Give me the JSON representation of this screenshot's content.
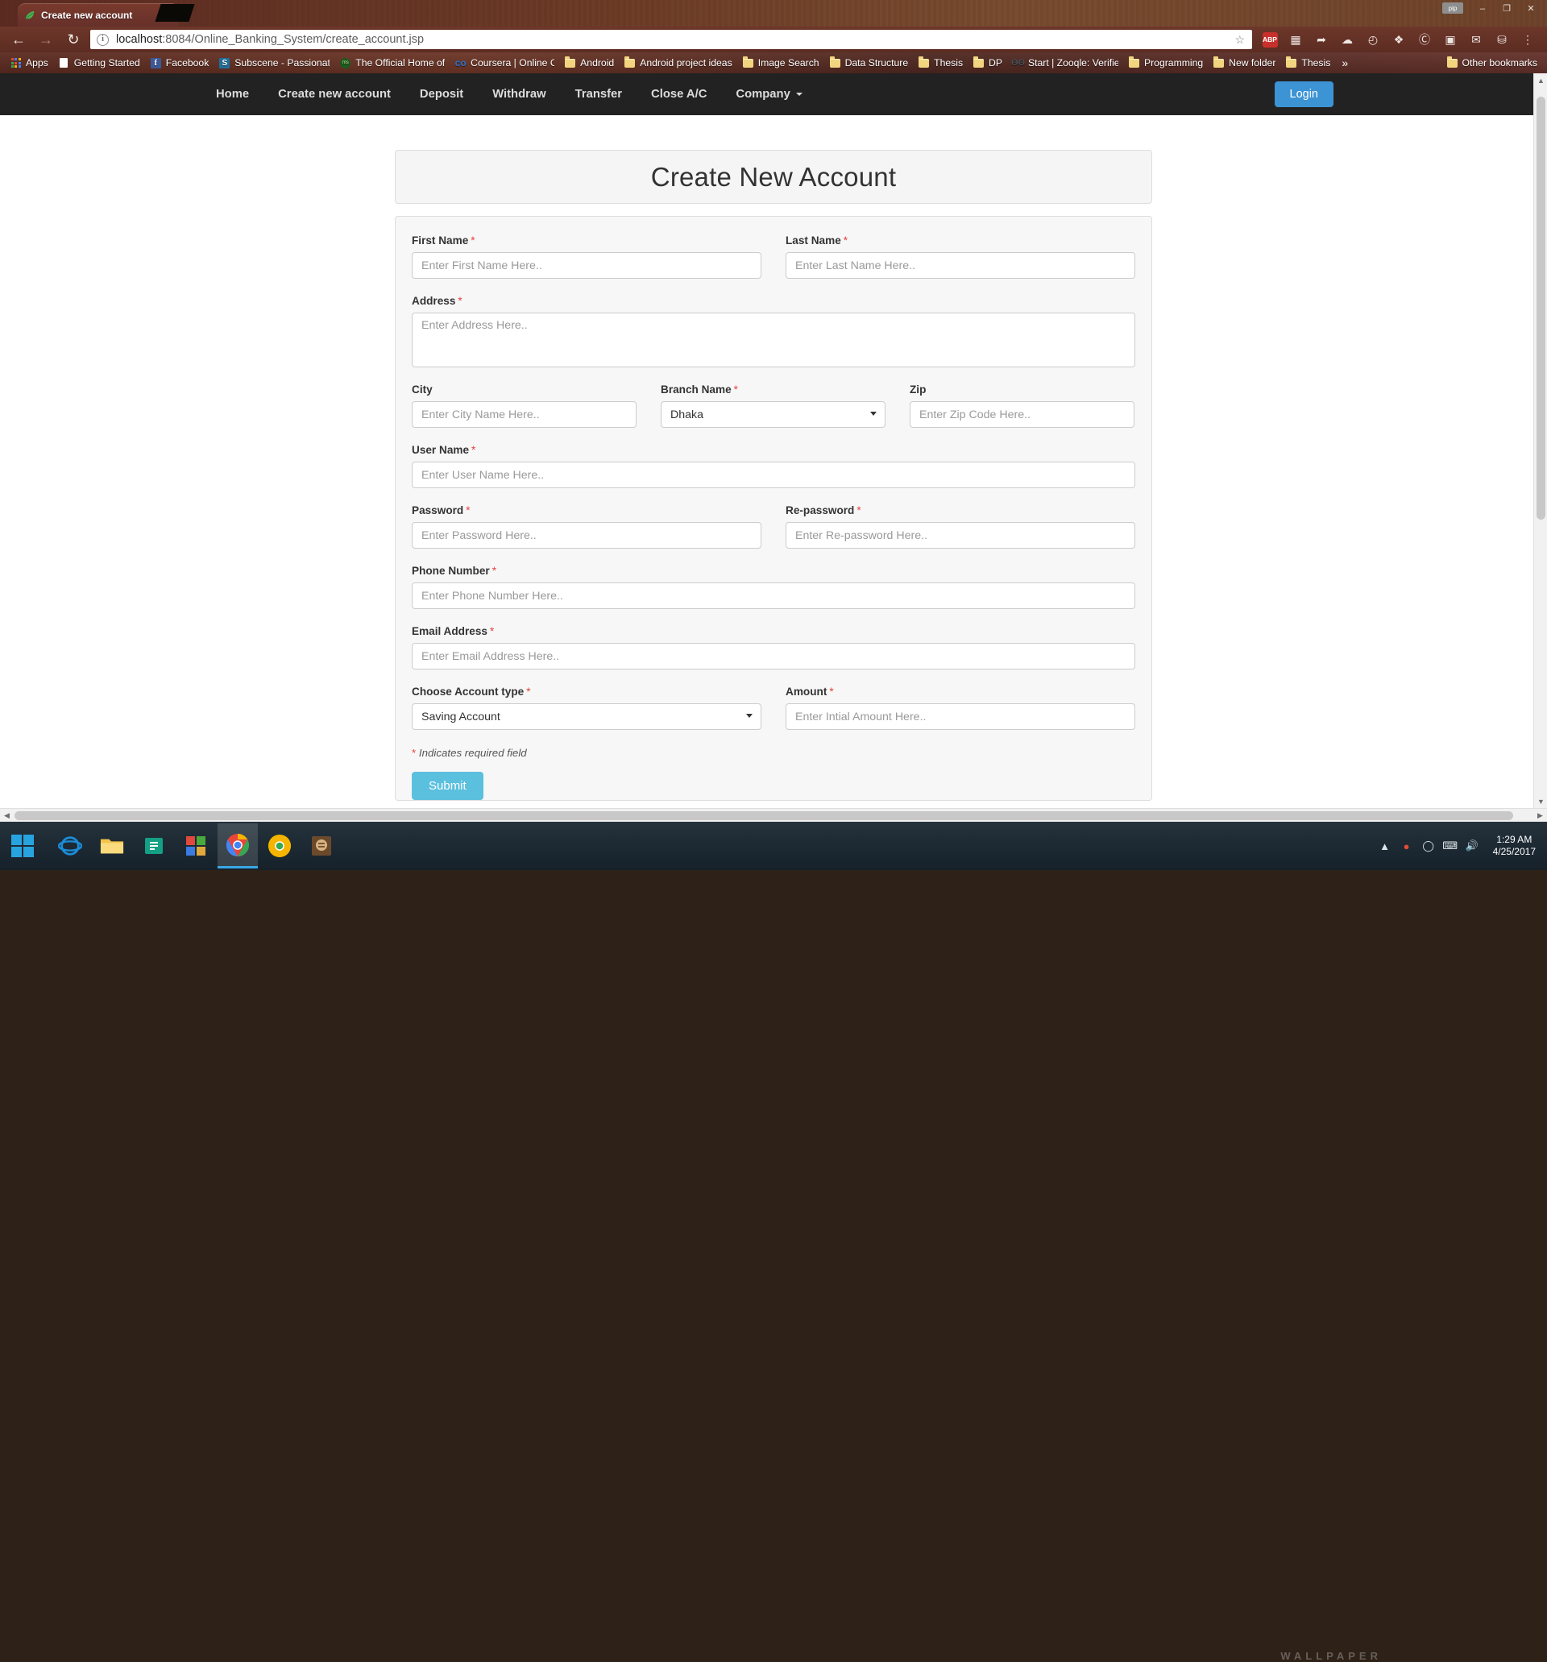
{
  "browser": {
    "tab": {
      "title": "Create new account",
      "favicon": "leaf-icon",
      "close": "×"
    },
    "window_controls": {
      "minimize": "–",
      "maximize": "❐",
      "close": "✕",
      "pip_label": "pip"
    },
    "toolbar": {
      "back": "←",
      "forward": "→",
      "reload": "↻",
      "info_icon": "i",
      "url_host": "localhost",
      "url_rest": ":8084/Online_Banking_System/create_account.jsp",
      "star": "☆",
      "extensions": [
        {
          "name": "adblock-plus-icon",
          "label": "ABP"
        },
        {
          "name": "ext-grid-icon",
          "label": "▦"
        },
        {
          "name": "ext-share-icon",
          "label": "➦"
        },
        {
          "name": "ext-cloud-icon",
          "label": "☁"
        },
        {
          "name": "ext-clock-icon",
          "label": "◴"
        },
        {
          "name": "ext-puzzle-icon",
          "label": "❖"
        },
        {
          "name": "ext-avast-icon",
          "label": "Ⓒ"
        },
        {
          "name": "ext-camera-icon",
          "label": "▣"
        },
        {
          "name": "ext-mail-icon",
          "label": "✉"
        },
        {
          "name": "ext-cart-icon",
          "label": "⛁"
        },
        {
          "name": "chrome-menu-icon",
          "label": "⋮"
        }
      ]
    },
    "bookmarks": {
      "items": [
        {
          "label": "Apps",
          "icon": "apps-grid-icon"
        },
        {
          "label": "Getting Started",
          "icon": "document-icon"
        },
        {
          "label": "Facebook",
          "icon": "facebook-icon"
        },
        {
          "label": "Subscene - Passionate",
          "icon": "subscene-icon"
        },
        {
          "label": "The Official Home of",
          "icon": "ms-icon"
        },
        {
          "label": "Coursera | Online Cou",
          "icon": "coursera-icon"
        },
        {
          "label": "Android",
          "icon": "folder-icon"
        },
        {
          "label": "Android project ideas",
          "icon": "folder-icon"
        },
        {
          "label": "Image Search",
          "icon": "folder-icon"
        },
        {
          "label": "Data Structure",
          "icon": "folder-icon"
        },
        {
          "label": "Thesis",
          "icon": "folder-icon"
        },
        {
          "label": "DP",
          "icon": "folder-icon"
        },
        {
          "label": "Start | Zooqle: Verified",
          "icon": "zooqle-icon"
        },
        {
          "label": "Programming",
          "icon": "folder-icon"
        },
        {
          "label": "New folder",
          "icon": "folder-icon"
        },
        {
          "label": "Thesis",
          "icon": "folder-icon"
        }
      ],
      "overflow": "»",
      "other_bookmarks": {
        "label": "Other bookmarks",
        "icon": "folder-icon"
      }
    }
  },
  "site": {
    "navbar": {
      "links": [
        {
          "label": "Home",
          "caret": false
        },
        {
          "label": "Create new account",
          "caret": false
        },
        {
          "label": "Deposit",
          "caret": false
        },
        {
          "label": "Withdraw",
          "caret": false
        },
        {
          "label": "Transfer",
          "caret": false
        },
        {
          "label": "Close A/C",
          "caret": false
        },
        {
          "label": "Company",
          "caret": true
        }
      ],
      "login_label": "Login",
      "login_color": "#3c94d4",
      "background": "#222222"
    },
    "page_title": "Create New Account",
    "form": {
      "required_marker": "*",
      "fields": {
        "first_name": {
          "label": "First Name",
          "required": true,
          "placeholder": "Enter First Name Here.."
        },
        "last_name": {
          "label": "Last Name",
          "required": true,
          "placeholder": "Enter Last Name Here.."
        },
        "address": {
          "label": "Address",
          "required": true,
          "placeholder": "Enter Address Here.."
        },
        "city": {
          "label": "City",
          "required": false,
          "placeholder": "Enter City Name Here.."
        },
        "branch_name": {
          "label": "Branch Name",
          "required": true,
          "value": "Dhaka"
        },
        "zip": {
          "label": "Zip",
          "required": false,
          "placeholder": "Enter Zip Code Here.."
        },
        "user_name": {
          "label": "User Name",
          "required": true,
          "placeholder": "Enter User Name Here.."
        },
        "password": {
          "label": "Password",
          "required": true,
          "placeholder": "Enter Password Here.."
        },
        "re_password": {
          "label": "Re-password",
          "required": true,
          "placeholder": "Enter Re-password Here.."
        },
        "phone_number": {
          "label": "Phone Number",
          "required": true,
          "placeholder": "Enter Phone Number Here.."
        },
        "email_address": {
          "label": "Email Address",
          "required": true,
          "placeholder": "Enter Email Address Here.."
        },
        "account_type": {
          "label": "Choose Account type",
          "required": true,
          "value": "Saving Account"
        },
        "amount": {
          "label": "Amount",
          "required": true,
          "placeholder": "Enter Intial Amount Here.."
        }
      },
      "required_note": "Indicates required field",
      "submit_label": "Submit",
      "submit_color": "#5bc0de"
    }
  },
  "taskbar": {
    "start": "windows-logo",
    "apps": [
      {
        "name": "internet-explorer-icon"
      },
      {
        "name": "file-explorer-icon"
      },
      {
        "name": "store-icon"
      },
      {
        "name": "media-player-icon"
      },
      {
        "name": "chrome-icon"
      },
      {
        "name": "chrome-canary-icon"
      },
      {
        "name": "game-icon"
      }
    ],
    "tray": [
      {
        "name": "show-hidden-icons",
        "glyph": "▲"
      },
      {
        "name": "antivirus-icon",
        "glyph": "Ⓐ"
      },
      {
        "name": "network-icon",
        "glyph": "◧"
      },
      {
        "name": "keyboard-icon",
        "glyph": "⌨"
      },
      {
        "name": "volume-icon",
        "glyph": "◂"
      }
    ],
    "clock_time": "1:29 AM",
    "clock_date": "4/25/2017",
    "wallpaper_watermark": "WALLPAPER"
  }
}
